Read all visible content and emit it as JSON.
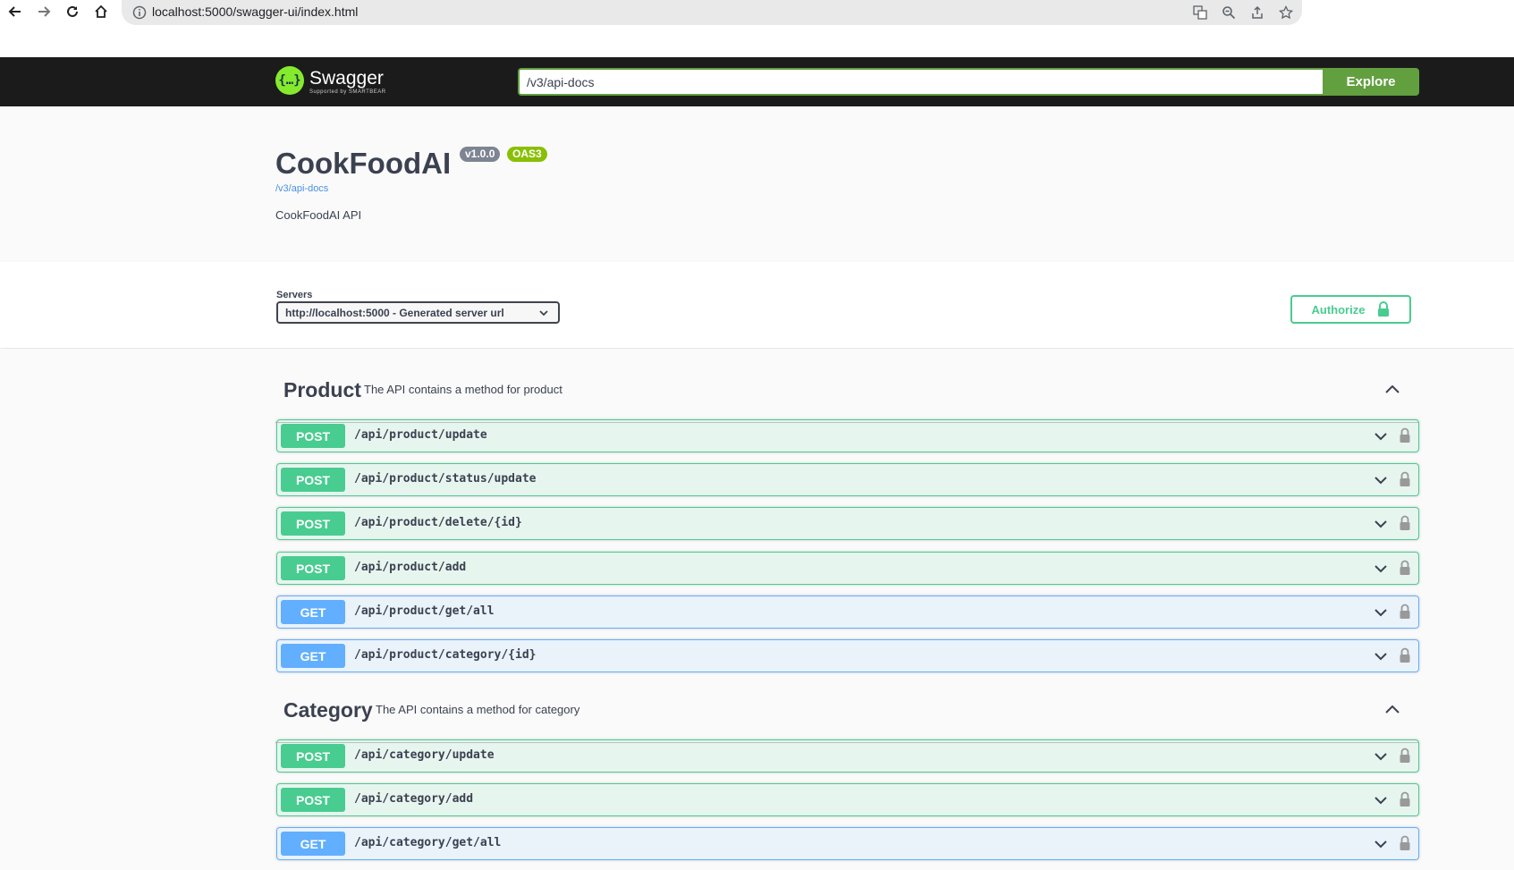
{
  "browser": {
    "url": "localhost:5000/swagger-ui/index.html"
  },
  "topbar": {
    "logo_text": "Swagger",
    "logo_sub": "Supported by SMARTBEAR",
    "spec_url": "/v3/api-docs",
    "explore_label": "Explore"
  },
  "info": {
    "title": "CookFoodAI",
    "version": "v1.0.0",
    "oas": "OAS3",
    "spec_link": "/v3/api-docs",
    "description": "CookFoodAI API"
  },
  "servers": {
    "label": "Servers",
    "selected": "http://localhost:5000 - Generated server url",
    "authorize_label": "Authorize"
  },
  "tags": [
    {
      "name": "Product",
      "description": "The API contains a method for product",
      "operations": [
        {
          "method": "POST",
          "path": "/api/product/update"
        },
        {
          "method": "POST",
          "path": "/api/product/status/update"
        },
        {
          "method": "POST",
          "path": "/api/product/delete/{id}"
        },
        {
          "method": "POST",
          "path": "/api/product/add"
        },
        {
          "method": "GET",
          "path": "/api/product/get/all"
        },
        {
          "method": "GET",
          "path": "/api/product/category/{id}"
        }
      ]
    },
    {
      "name": "Category",
      "description": "The API contains a method for category",
      "operations": [
        {
          "method": "POST",
          "path": "/api/category/update"
        },
        {
          "method": "POST",
          "path": "/api/category/add"
        },
        {
          "method": "GET",
          "path": "/api/category/get/all"
        }
      ]
    }
  ],
  "colors": {
    "post": "#49cc90",
    "get": "#61affe",
    "explore": "#62a03f",
    "topbar": "#1b1b1b"
  }
}
